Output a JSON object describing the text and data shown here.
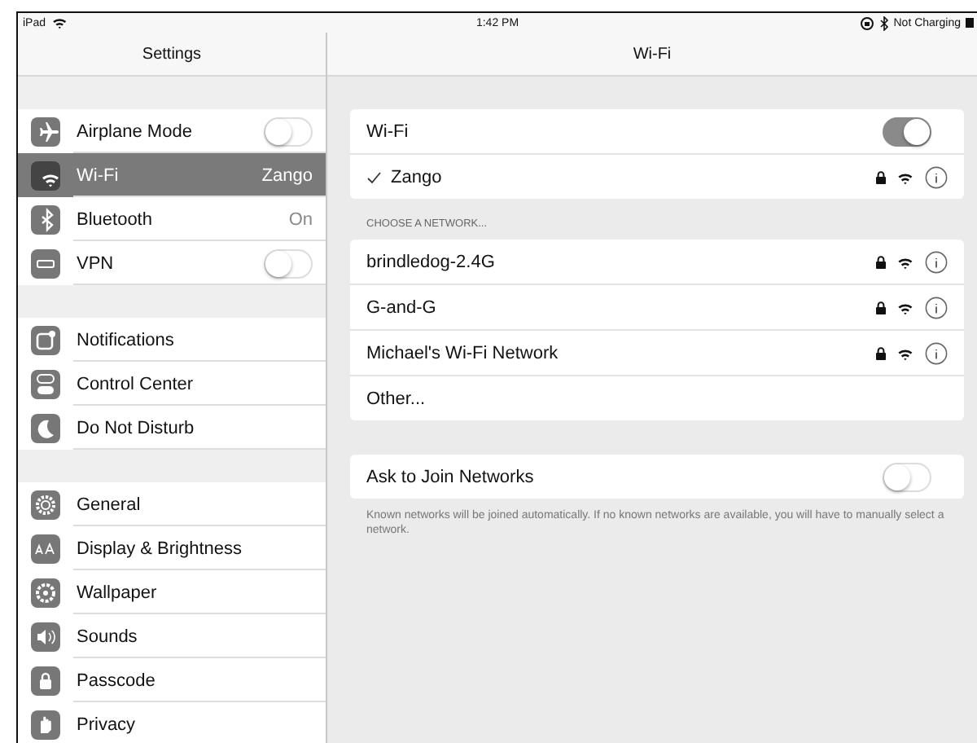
{
  "status_bar": {
    "device": "iPad",
    "time": "1:42 PM",
    "battery_text": "Not Charging"
  },
  "sidebar": {
    "title": "Settings",
    "groups": [
      [
        {
          "label": "Airplane Mode",
          "kind": "toggle",
          "on": false,
          "selected": false
        },
        {
          "label": "Wi-Fi",
          "kind": "value",
          "value": "Zango",
          "selected": true
        },
        {
          "label": "Bluetooth",
          "kind": "value",
          "value": "On",
          "selected": false
        },
        {
          "label": "VPN",
          "kind": "toggle",
          "on": false,
          "selected": false
        }
      ],
      [
        {
          "label": "Notifications",
          "kind": "plain",
          "selected": false
        },
        {
          "label": "Control Center",
          "kind": "plain",
          "selected": false
        },
        {
          "label": "Do Not Disturb",
          "kind": "plain",
          "selected": false
        }
      ],
      [
        {
          "label": "General",
          "kind": "plain",
          "selected": false
        },
        {
          "label": "Display & Brightness",
          "kind": "plain",
          "selected": false
        },
        {
          "label": "Wallpaper",
          "kind": "plain",
          "selected": false
        },
        {
          "label": "Sounds",
          "kind": "plain",
          "selected": false
        },
        {
          "label": "Passcode",
          "kind": "plain",
          "selected": false
        },
        {
          "label": "Privacy",
          "kind": "plain",
          "selected": false
        }
      ]
    ]
  },
  "detail": {
    "title": "Wi-Fi",
    "wifi_toggle": {
      "label": "Wi-Fi",
      "on": true
    },
    "current_network": {
      "name": "Zango",
      "checked": true
    },
    "section_header": "CHOOSE A NETWORK...",
    "networks": [
      {
        "name": "brindledog-2.4G",
        "kind": "network"
      },
      {
        "name": "G-and-G",
        "kind": "network"
      },
      {
        "name": "Michael's Wi-Fi Network",
        "kind": "network"
      },
      {
        "name": "Other...",
        "kind": "other"
      }
    ],
    "ask_to_join": {
      "label": "Ask to Join Networks",
      "on": false
    },
    "footnote": "Known networks will be joined automatically. If no known networks are available, you will have to manually select a network."
  }
}
